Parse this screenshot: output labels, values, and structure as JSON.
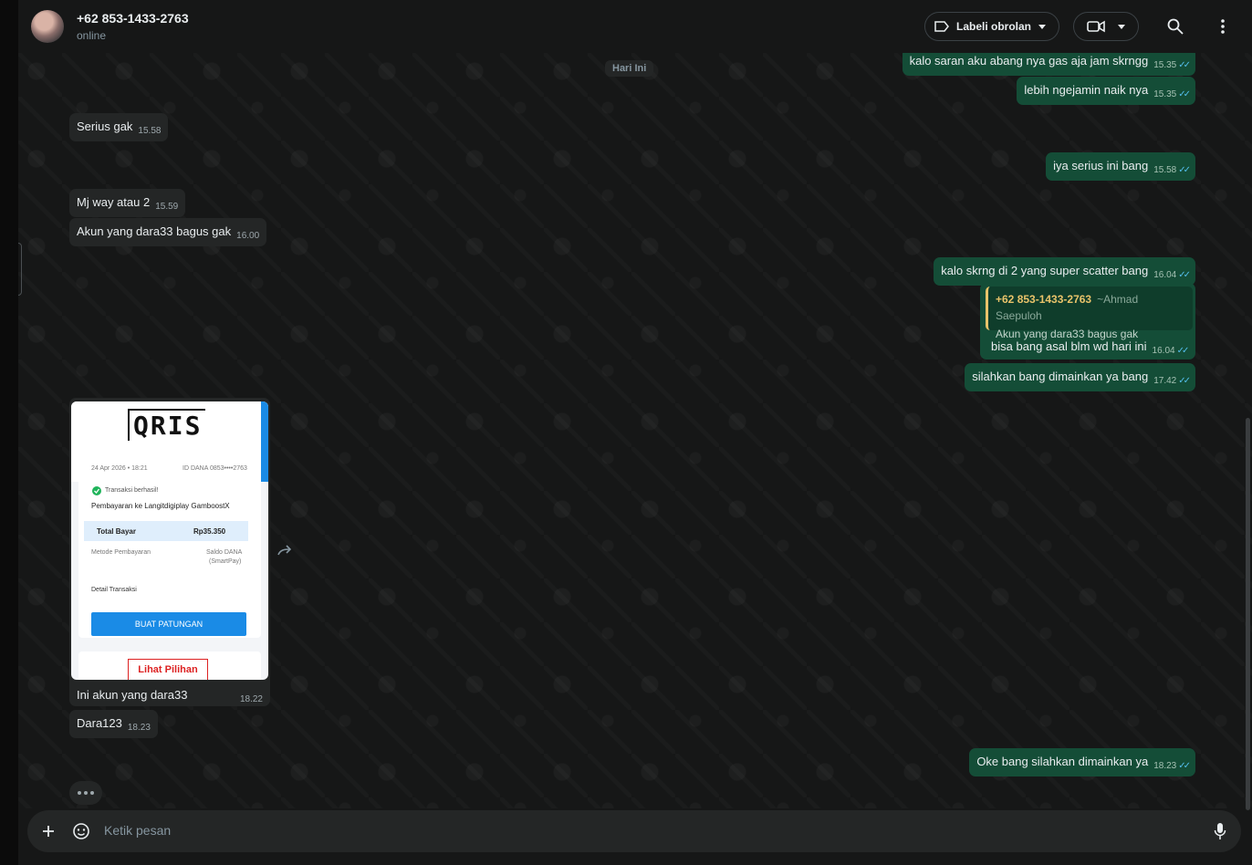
{
  "header": {
    "contact_name": "+62 853-1433-2763",
    "status": "online",
    "label_button": "Labeli obrolan"
  },
  "date_divider": "Hari Ini",
  "messages": {
    "out1": {
      "text": "kalo saran aku abang nya gas aja jam skrngg",
      "time": "15.35"
    },
    "out2": {
      "text": "lebih ngejamin naik nya",
      "time": "15.35"
    },
    "in1": {
      "text": "Serius gak",
      "time": "15.58"
    },
    "out3": {
      "text": "iya serius ini bang",
      "time": "15.58"
    },
    "in2": {
      "text": "Mj way atau 2",
      "time": "15.59"
    },
    "in3": {
      "text": "Akun yang dara33 bagus gak",
      "time": "16.00"
    },
    "out4": {
      "text": "kalo skrng di 2 yang super scatter bang",
      "time": "16.04"
    },
    "quote": {
      "name": "+62 853-1433-2763",
      "author": "~Ahmad Saepuloh",
      "text": "Akun yang dara33 bagus gak"
    },
    "out5": {
      "text": "bisa bang asal blm wd hari ini",
      "time": "16.04"
    },
    "out6": {
      "text": "silahkan bang dimainkan ya bang",
      "time": "17.42"
    },
    "in4": {
      "text": "Ini akun yang dara33",
      "time": "18.22"
    },
    "in5": {
      "text": "Dara123",
      "time": "18.23"
    },
    "out7": {
      "text": "Oke bang silahkan dimainkan ya",
      "time": "18.23"
    }
  },
  "receipt": {
    "logo": "QRIS",
    "date": "24 Apr 2026 • 18:21",
    "id": "ID DANA 0853••••2763",
    "status": "Transaksi berhasil!",
    "merchant": "Pembayaran ke Langitdigiplay GamboostX",
    "total_label": "Total Bayar",
    "total_value": "Rp35.350",
    "method_label": "Metode Pembayaran",
    "method_value_1": "Saldo DANA",
    "method_value_2": "(SmartPay)",
    "detail": "Detail Transaksi",
    "button": "BUAT PATUNGAN",
    "bottom_button": "Lihat Pilihan"
  },
  "composer": {
    "placeholder": "Ketik pesan"
  },
  "ticks": "✓✓"
}
